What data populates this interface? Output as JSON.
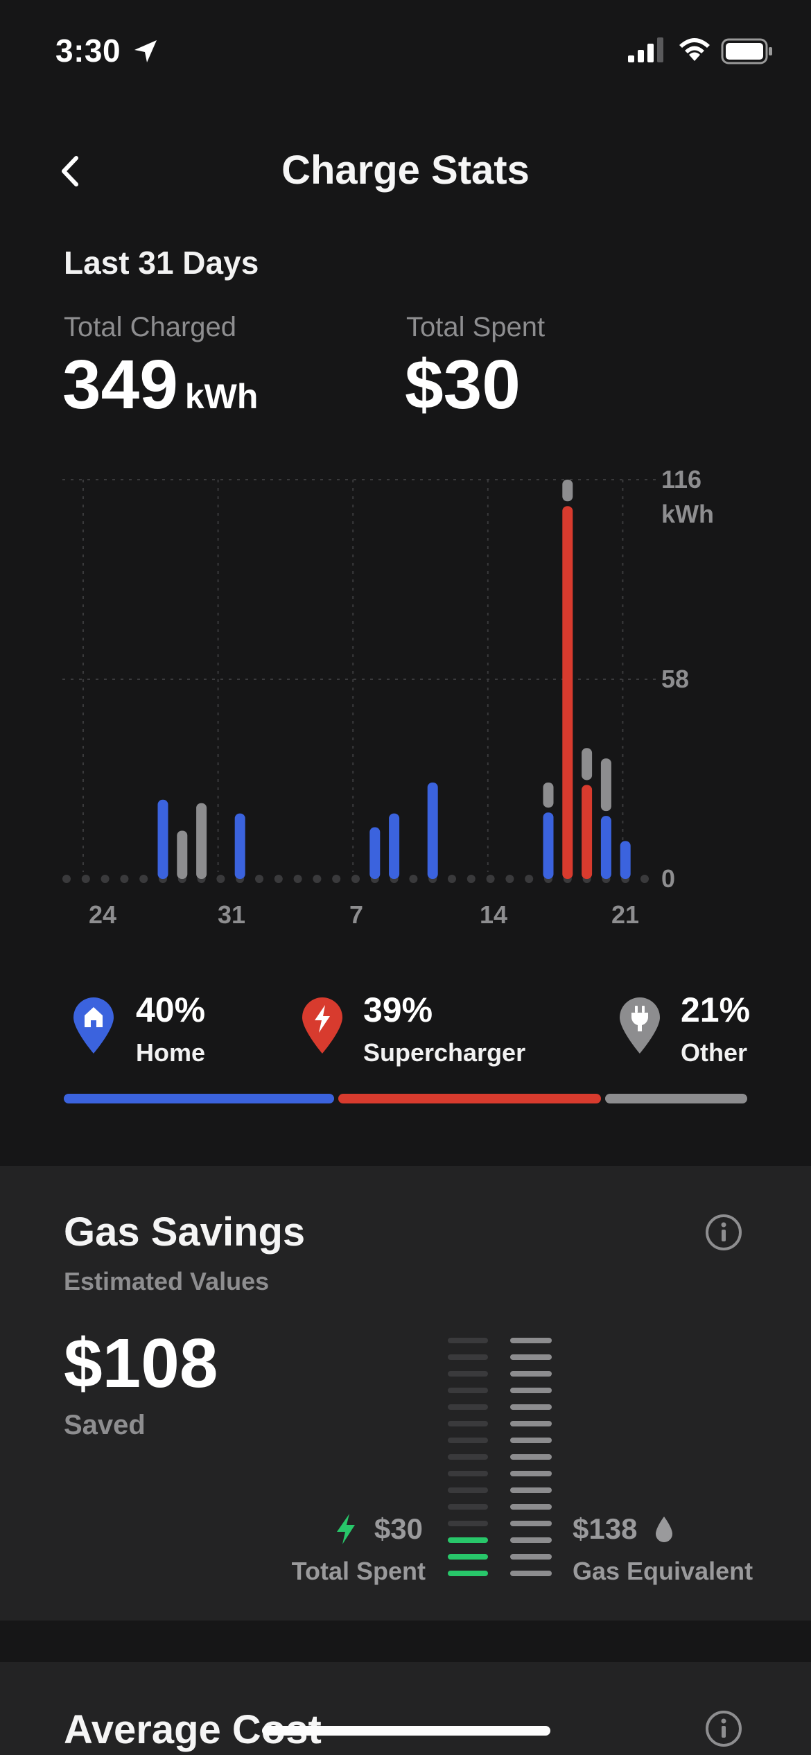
{
  "status_bar": {
    "time": "3:30"
  },
  "header": {
    "title": "Charge Stats"
  },
  "summary": {
    "period": "Last 31 Days",
    "total_charged_label": "Total Charged",
    "total_charged_value": "349",
    "total_charged_unit": "kWh",
    "total_spent_label": "Total Spent",
    "total_spent_value": "$30"
  },
  "chart_data": {
    "type": "bar",
    "stacked": true,
    "x_tick_labels": [
      "24",
      "31",
      "7",
      "14",
      "21"
    ],
    "y_tick_labels": [
      "116\nkWh",
      "58",
      "0"
    ],
    "ylim": [
      0,
      116
    ],
    "grid": true,
    "days": [
      "24",
      "25",
      "26",
      "27",
      "28",
      "29",
      "30",
      "31",
      "1",
      "2",
      "3",
      "4",
      "5",
      "6",
      "7",
      "8",
      "9",
      "10",
      "11",
      "12",
      "13",
      "14",
      "15",
      "16",
      "17",
      "18",
      "19",
      "20",
      "21",
      "22",
      "23"
    ],
    "series": [
      {
        "name": "Home",
        "color": "#3b63de",
        "values": [
          0,
          0,
          0,
          0,
          0,
          23,
          0,
          0,
          0,
          19,
          0,
          0,
          0,
          0,
          0,
          0,
          15,
          19,
          0,
          28,
          0,
          0,
          0,
          0,
          0,
          20,
          0,
          0,
          19,
          11,
          0
        ]
      },
      {
        "name": "Supercharger",
        "color": "#d83b2e",
        "values": [
          0,
          0,
          0,
          0,
          0,
          0,
          0,
          0,
          0,
          0,
          0,
          0,
          0,
          0,
          0,
          0,
          0,
          0,
          0,
          0,
          0,
          0,
          0,
          0,
          0,
          0,
          109,
          28,
          0,
          0,
          0
        ]
      },
      {
        "name": "Other",
        "color": "#8d8d8f",
        "values": [
          0,
          0,
          0,
          0,
          0,
          0,
          14,
          22,
          0,
          0,
          0,
          0,
          0,
          0,
          0,
          0,
          0,
          0,
          0,
          0,
          0,
          0,
          0,
          0,
          0,
          8,
          7,
          10,
          16,
          0,
          0
        ]
      }
    ]
  },
  "breakdown": [
    {
      "percent": "40%",
      "name": "Home",
      "color": "#3b63de",
      "share": 40,
      "icon": "home-icon"
    },
    {
      "percent": "39%",
      "name": "Supercharger",
      "color": "#d83b2e",
      "share": 39,
      "icon": "supercharger-bolt-icon"
    },
    {
      "percent": "21%",
      "name": "Other",
      "color": "#8d8d8f",
      "share": 21,
      "icon": "plug-icon"
    }
  ],
  "gas_savings": {
    "title": "Gas Savings",
    "subtitle": "Estimated Values",
    "saved_value": "$108",
    "saved_label": "Saved",
    "total_spent_amount": "$30",
    "total_spent_label": "Total Spent",
    "gas_equivalent_amount": "$138",
    "gas_equivalent_label": "Gas Equivalent",
    "spent_level": 0.22,
    "accent": "#28c76a"
  },
  "average_cost": {
    "title": "Average Cost"
  }
}
